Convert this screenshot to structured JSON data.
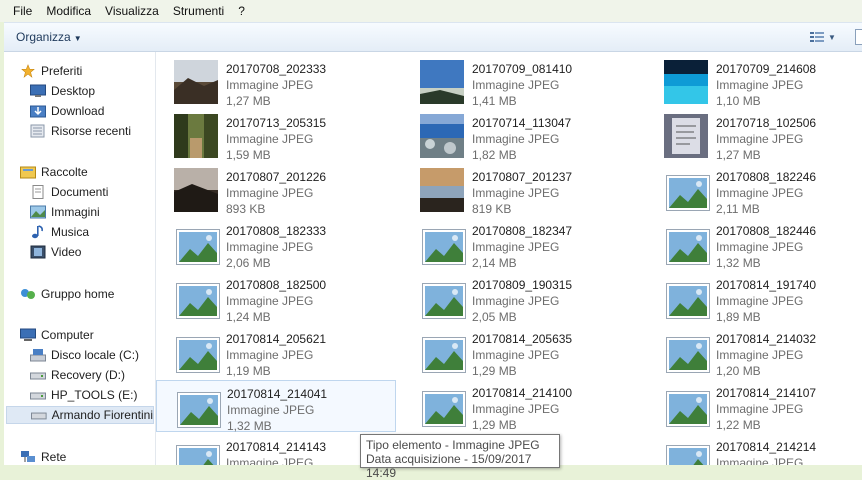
{
  "menu": [
    "File",
    "Modifica",
    "Visualizza",
    "Strumenti",
    "?"
  ],
  "toolbar": {
    "organize_label": "Organizza",
    "organize_caret": "▼",
    "view_icon": "details-view-icon",
    "view_caret": "▼"
  },
  "nav": {
    "favorites": {
      "label": "Preferiti",
      "items": [
        "Desktop",
        "Download",
        "Risorse recenti"
      ]
    },
    "libraries": {
      "label": "Raccolte",
      "items": [
        "Documenti",
        "Immagini",
        "Musica",
        "Video"
      ]
    },
    "homegroup": {
      "label": "Gruppo home"
    },
    "computer": {
      "label": "Computer",
      "items": [
        "Disco locale (C:)",
        "Recovery (D:)",
        "HP_TOOLS (E:)",
        "Armando Fiorentini"
      ]
    },
    "network": {
      "label": "Rete"
    }
  },
  "files": [
    {
      "name": "20170708_202333",
      "type": "Immagine JPEG",
      "size": "1,27 MB",
      "thumb": "photo-sunset-cliffs"
    },
    {
      "name": "20170709_081410",
      "type": "Immagine JPEG",
      "size": "1,41 MB",
      "thumb": "photo-sky-coast"
    },
    {
      "name": "20170709_214608",
      "type": "Immagine JPEG",
      "size": "1,10 MB",
      "thumb": "photo-blue-pool"
    },
    {
      "name": "20170713_205315",
      "type": "Immagine JPEG",
      "size": "1,59 MB",
      "thumb": "photo-trees-path"
    },
    {
      "name": "20170714_113047",
      "type": "Immagine JPEG",
      "size": "1,82 MB",
      "thumb": "photo-sea-rocks"
    },
    {
      "name": "20170718_102506",
      "type": "Immagine JPEG",
      "size": "1,27 MB",
      "thumb": "photo-document"
    },
    {
      "name": "20170807_201226",
      "type": "Immagine JPEG",
      "size": "893 KB",
      "thumb": "photo-dusk-hills"
    },
    {
      "name": "20170807_201237",
      "type": "Immagine JPEG",
      "size": "819 KB",
      "thumb": "photo-dusk-sky"
    },
    {
      "name": "20170808_182246",
      "type": "Immagine JPEG",
      "size": "2,11 MB",
      "thumb": "image-file-icon"
    },
    {
      "name": "20170808_182333",
      "type": "Immagine JPEG",
      "size": "2,06 MB",
      "thumb": "image-file-icon"
    },
    {
      "name": "20170808_182347",
      "type": "Immagine JPEG",
      "size": "2,14 MB",
      "thumb": "image-file-icon"
    },
    {
      "name": "20170808_182446",
      "type": "Immagine JPEG",
      "size": "1,32 MB",
      "thumb": "image-file-icon"
    },
    {
      "name": "20170808_182500",
      "type": "Immagine JPEG",
      "size": "1,24 MB",
      "thumb": "image-file-icon"
    },
    {
      "name": "20170809_190315",
      "type": "Immagine JPEG",
      "size": "2,05 MB",
      "thumb": "image-file-icon"
    },
    {
      "name": "20170814_191740",
      "type": "Immagine JPEG",
      "size": "1,89 MB",
      "thumb": "image-file-icon"
    },
    {
      "name": "20170814_205621",
      "type": "Immagine JPEG",
      "size": "1,19 MB",
      "thumb": "image-file-icon"
    },
    {
      "name": "20170814_205635",
      "type": "Immagine JPEG",
      "size": "1,29 MB",
      "thumb": "image-file-icon"
    },
    {
      "name": "20170814_214032",
      "type": "Immagine JPEG",
      "size": "1,20 MB",
      "thumb": "image-file-icon"
    },
    {
      "name": "20170814_214041",
      "type": "Immagine JPEG",
      "size": "1,32 MB",
      "thumb": "image-file-icon",
      "selected": true
    },
    {
      "name": "20170814_214100",
      "type": "Immagine JPEG",
      "size": "1,29 MB",
      "thumb": "image-file-icon"
    },
    {
      "name": "20170814_214107",
      "type": "Immagine JPEG",
      "size": "1,22 MB",
      "thumb": "image-file-icon"
    },
    {
      "name": "20170814_214143",
      "type": "Immagine JPEG",
      "size": "",
      "thumb": "image-file-icon"
    },
    {
      "name": "",
      "type": "",
      "size": "",
      "thumb": "image-file-icon"
    },
    {
      "name": "20170814_214214",
      "type": "Immagine JPEG",
      "size": "",
      "thumb": "image-file-icon"
    }
  ],
  "tooltip": {
    "line1": "Tipo elemento - Immagine JPEG",
    "line2": "Data acquisizione - 15/09/2017 14:49"
  },
  "colors": {
    "nav_selected": "#dfe9f5",
    "file_selected": "#f4f9ff",
    "accent": "#1e395b"
  }
}
